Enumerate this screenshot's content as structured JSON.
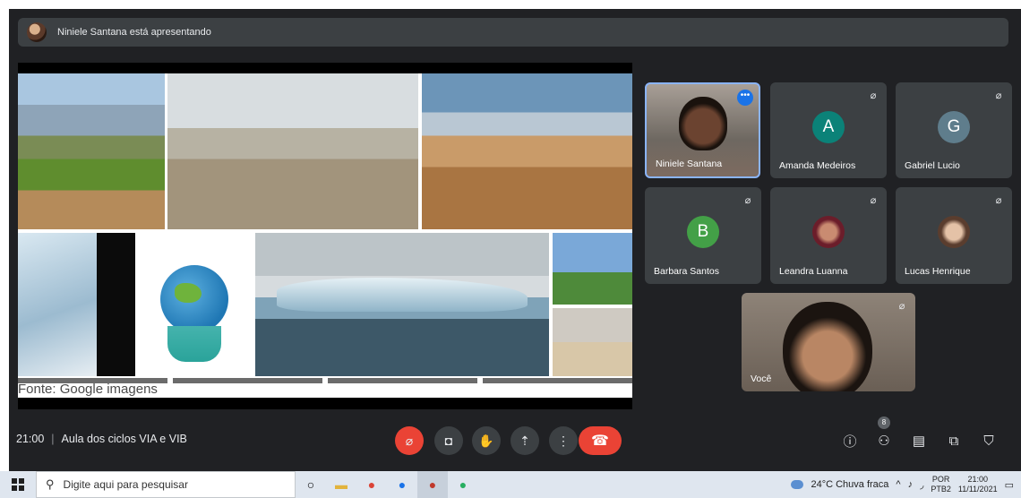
{
  "banner": {
    "text": "Niniele Santana está apresentando"
  },
  "slide": {
    "caption": "Fonte: Google imagens"
  },
  "participants": [
    {
      "name": "Niniele Santana"
    },
    {
      "name": "Amanda Medeiros",
      "initial": "A",
      "color": "#0b8278"
    },
    {
      "name": "Gabriel Lucio",
      "initial": "G",
      "color": "#5f7d8c"
    },
    {
      "name": "Barbara Santos",
      "initial": "B",
      "color": "#43a047"
    },
    {
      "name": "Leandra Luanna"
    },
    {
      "name": "Lucas Henrique"
    },
    {
      "name": "Você"
    }
  ],
  "controls": {
    "time": "21:00",
    "meeting_title": "Aula dos ciclos VIA e VIB",
    "people_count": "8"
  },
  "taskbar": {
    "search_placeholder": "Digite aqui para pesquisar",
    "weather": "24°C  Chuva fraca",
    "lang_top": "POR",
    "lang_bottom": "PTB2",
    "clock_time": "21:00",
    "clock_date": "11/11/2021"
  }
}
